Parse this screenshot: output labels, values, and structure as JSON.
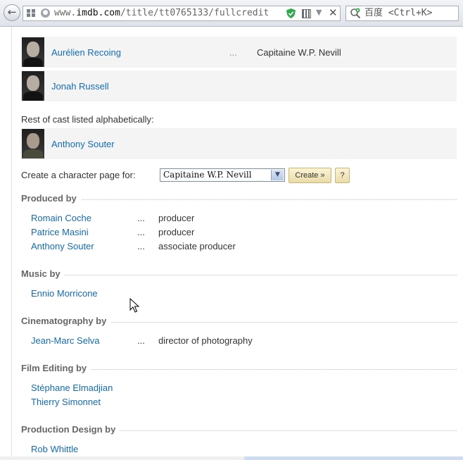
{
  "browser": {
    "url_prefix": "www.",
    "url_domain": "imdb.com",
    "url_path": "/title/tt0765133/fullcredit",
    "search_text": "百度 <Ctrl+K>"
  },
  "cast": [
    {
      "name": "Aurélien Recoing",
      "ellipsis": "...",
      "character": "Capitaine W.P. Nevill"
    },
    {
      "name": "Jonah Russell",
      "ellipsis": "",
      "character": ""
    },
    {
      "name": "Anthony Souter",
      "ellipsis": "",
      "character": ""
    }
  ],
  "rest_label": "Rest of cast listed alphabetically:",
  "create_row": {
    "label": "Create a character page for:",
    "selected": "Capitaine W.P. Nevill",
    "create_button": "Create »",
    "help_button": "?"
  },
  "sections": [
    {
      "heading": "Produced by",
      "credits": [
        {
          "name": "Romain Coche",
          "dots": "...",
          "role": "producer"
        },
        {
          "name": "Patrice Masini",
          "dots": "...",
          "role": "producer"
        },
        {
          "name": "Anthony Souter",
          "dots": "...",
          "role": "associate producer"
        }
      ]
    },
    {
      "heading": "Music by",
      "credits": [
        {
          "name": "Ennio Morricone",
          "dots": "",
          "role": ""
        }
      ]
    },
    {
      "heading": "Cinematography by",
      "credits": [
        {
          "name": "Jean-Marc Selva",
          "dots": "...",
          "role": "director of photography"
        }
      ]
    },
    {
      "heading": "Film Editing by",
      "credits": [
        {
          "name": "Stéphane Elmadjian",
          "dots": "",
          "role": ""
        },
        {
          "name": "Thierry Simonnet",
          "dots": "",
          "role": ""
        }
      ]
    },
    {
      "heading": "Production Design by",
      "credits": [
        {
          "name": "Rob Whittle",
          "dots": "",
          "role": ""
        }
      ]
    }
  ],
  "colors": {
    "link": "#136cb2",
    "text": "#333333",
    "heading": "#666666",
    "row_bg": "#f4f4f4"
  }
}
